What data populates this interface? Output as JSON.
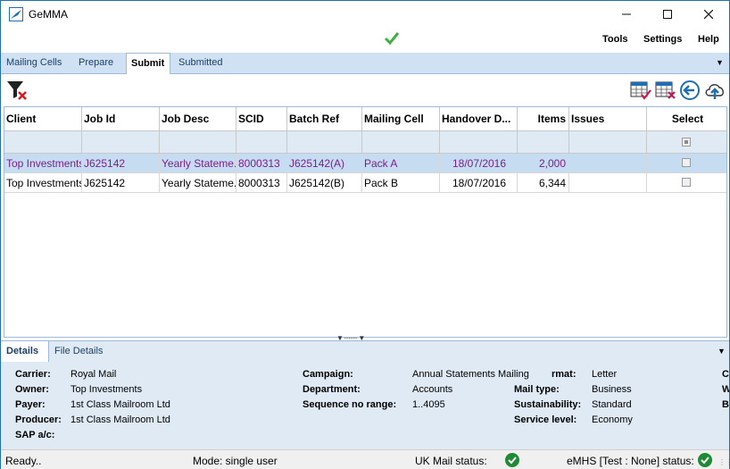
{
  "window": {
    "title": "GeMMA"
  },
  "menu": {
    "tools": "Tools",
    "settings": "Settings",
    "help": "Help"
  },
  "tabs": [
    "Mailing Cells",
    "Prepare",
    "Submit",
    "Submitted"
  ],
  "active_tab": "Submit",
  "grid": {
    "columns": [
      "Client",
      "Job Id",
      "Job Desc",
      "SCID",
      "Batch Ref",
      "Mailing Cell",
      "Handover D...",
      "Items",
      "Issues",
      "Select"
    ],
    "rows": [
      {
        "client": "Top Investments",
        "job_id": "J625142",
        "job_desc": "Yearly Stateme...",
        "scid": "8000313",
        "batch_ref": "J625142(A)",
        "mailing_cell": "Pack A",
        "handover": "18/07/2016",
        "items": "2,000",
        "issues": "",
        "selected": false
      },
      {
        "client": "Top Investments",
        "job_id": "J625142",
        "job_desc": "Yearly Stateme...",
        "scid": "8000313",
        "batch_ref": "J625142(B)",
        "mailing_cell": "Pack B",
        "handover": "18/07/2016",
        "items": "6,344",
        "issues": "",
        "selected": false
      }
    ]
  },
  "details_tabs": {
    "details": "Details",
    "file_details": "File Details"
  },
  "details": {
    "carrier_label": "Carrier:",
    "carrier": "Royal Mail",
    "owner_label": "Owner:",
    "owner": "Top Investments",
    "payer_label": "Payer:",
    "payer": "1st Class Mailroom Ltd",
    "producer_label": "Producer:",
    "producer": "1st Class Mailroom Ltd",
    "sap_label": "SAP a/c:",
    "sap": "",
    "campaign_label": "Campaign:",
    "campaign": "Annual Statements Mailing",
    "department_label": "Department:",
    "department": "Accounts",
    "sequence_label": "Sequence no range:",
    "sequence": "1..4095",
    "format_label": "rmat:",
    "format": "Letter",
    "mail_type_label": "Mail type:",
    "mail_type": "Business",
    "sustainability_label": "Sustainability:",
    "sustainability": "Standard",
    "service_level_label": "Service level:",
    "service_level": "Economy",
    "col4_a": "C",
    "col4_b": "W",
    "col4_c": "B"
  },
  "status": {
    "ready": "Ready..",
    "mode": "Mode: single user",
    "uk_mail": "UK Mail status:",
    "emhs": "eMHS [Test : None] status:"
  },
  "colors": {
    "accent": "#1f6fb5",
    "tab_bg": "#cfe1f3",
    "selected_row": "#c6dcf1",
    "selected_text": "#7a1f8c",
    "ok_green": "#2e9e3e"
  }
}
